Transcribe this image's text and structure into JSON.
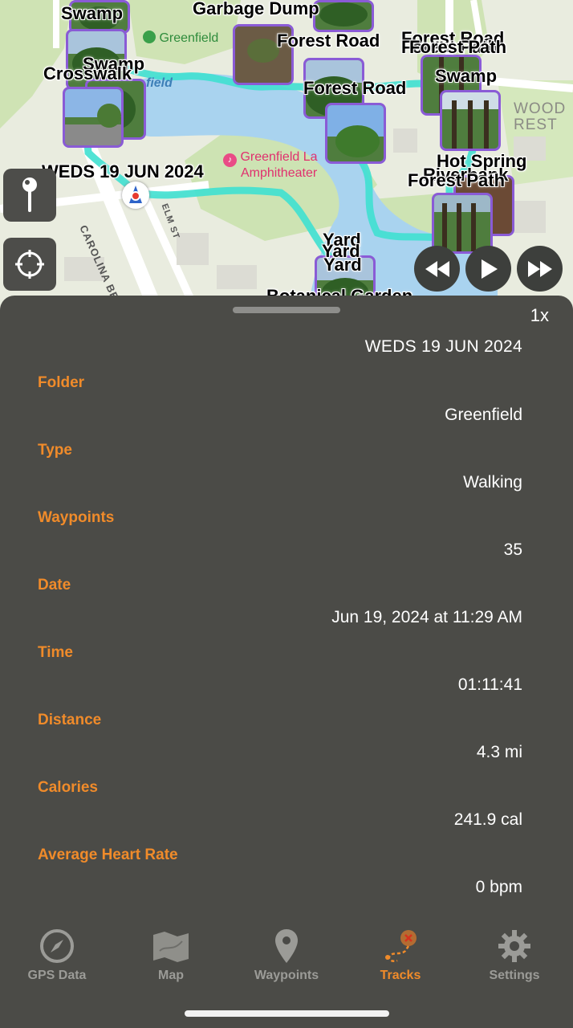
{
  "map": {
    "labels": {
      "swamp_top": "Swamp",
      "garbage_dump": "Garbage Dump",
      "forest_road_1": "Forest Road",
      "forest_road_2": "Forest Road",
      "forest_path_1": "Forest Path",
      "forest_path_2": "Forest Path",
      "swamp_mid": "Swamp",
      "crosswalk": "Crosswalk",
      "swamp_right": "Swamp",
      "forest_road_3": "Forest Road",
      "hot_spring": "Hot Spring",
      "riverbank": "Riverbank",
      "forest_path_3": "Forest Path",
      "yard_1": "Yard",
      "yard_2": "Yard",
      "yard_3": "Yard",
      "botanical_garden": "Botanical Garden",
      "date_label": "WEDS 19 JUN 2024"
    },
    "poi": {
      "greenfield_park": "Greenfield",
      "greenfield_water": "field",
      "amphitheater_1": "Greenfield La",
      "amphitheater_2": "Amphitheater",
      "wood_1": "WOOD",
      "wood_2": "REST"
    },
    "streets": {
      "carolina_beach": "CAROLINA BEACH",
      "elm_st": "ELM ST"
    }
  },
  "sheet": {
    "speed": "1x",
    "title": "WEDS 19 JUN 2024",
    "rows": [
      {
        "label": "Folder",
        "value": "Greenfield"
      },
      {
        "label": "Type",
        "value": "Walking"
      },
      {
        "label": "Waypoints",
        "value": "35"
      },
      {
        "label": "Date",
        "value": "Jun 19, 2024 at 11:29 AM"
      },
      {
        "label": "Time",
        "value": "01:11:41"
      },
      {
        "label": "Distance",
        "value": "4.3 mi"
      },
      {
        "label": "Calories",
        "value": "241.9 cal"
      },
      {
        "label": "Average Heart Rate",
        "value": "0 bpm"
      }
    ]
  },
  "tabs": [
    {
      "label": "GPS Data",
      "icon": "compass-icon",
      "active": false
    },
    {
      "label": "Map",
      "icon": "map-icon",
      "active": false
    },
    {
      "label": "Waypoints",
      "icon": "pin-icon",
      "active": false
    },
    {
      "label": "Tracks",
      "icon": "track-route-icon",
      "active": true
    },
    {
      "label": "Settings",
      "icon": "gear-icon",
      "active": false
    }
  ],
  "colors": {
    "accent": "#f08b2a",
    "route": "#3fe0d0",
    "thumb_border": "#8a5bd6",
    "sheet_bg": "#4b4b47"
  }
}
